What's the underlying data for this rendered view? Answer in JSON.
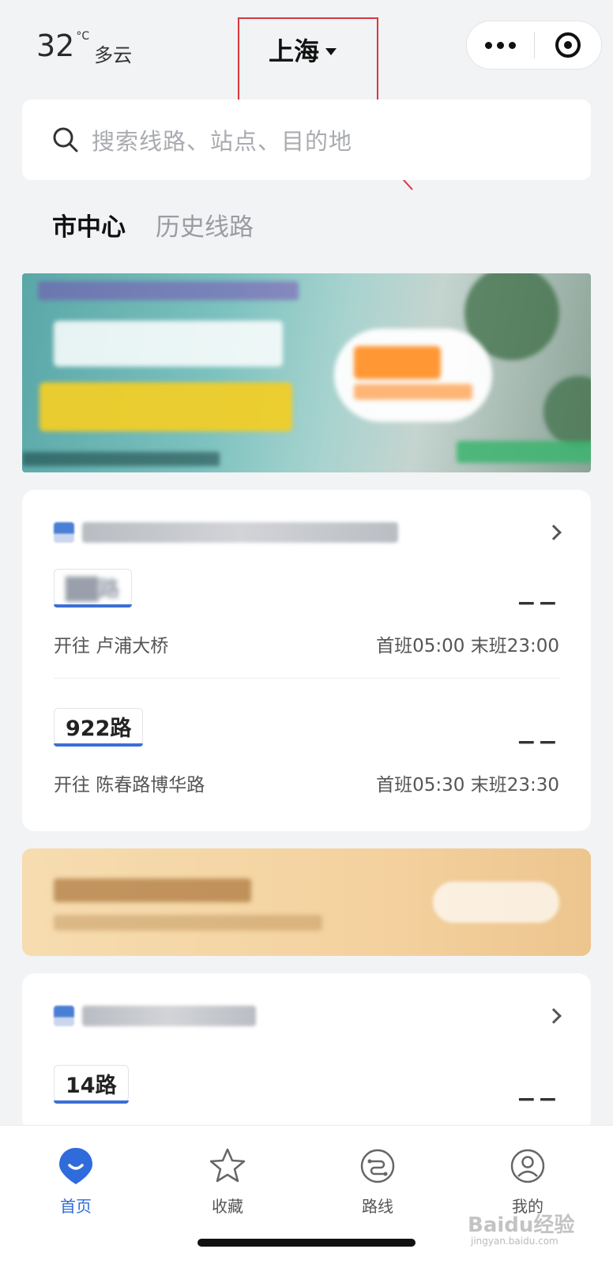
{
  "weather": {
    "temp": "32",
    "unit": "°C",
    "condition": "多云"
  },
  "header": {
    "city": "上海"
  },
  "search": {
    "placeholder": "搜索线路、站点、目的地"
  },
  "tabs": [
    {
      "label": "市中心",
      "active": true
    },
    {
      "label": "历史线路",
      "active": false
    }
  ],
  "stops": [
    {
      "routes": [
        {
          "name": "",
          "direction": "开往 卢浦大桥",
          "schedule": "首班05:00 末班23:00",
          "eta": "−−"
        },
        {
          "name": "922路",
          "direction": "开往 陈春路博华路",
          "schedule": "首班05:30 末班23:30",
          "eta": "−−"
        }
      ]
    },
    {
      "routes": [
        {
          "name": "14路",
          "eta": "−−"
        }
      ]
    }
  ],
  "tabbar": [
    {
      "label": "首页",
      "icon": "home-pin-icon",
      "active": true
    },
    {
      "label": "收藏",
      "icon": "star-icon",
      "active": false
    },
    {
      "label": "路线",
      "icon": "route-icon",
      "active": false
    },
    {
      "label": "我的",
      "icon": "user-icon",
      "active": false
    }
  ],
  "watermark": {
    "text": "Baidu经验",
    "sub": "jingyan.baidu.com"
  },
  "colors": {
    "accent": "#2f6bdb",
    "highlight": "#d9363e"
  }
}
